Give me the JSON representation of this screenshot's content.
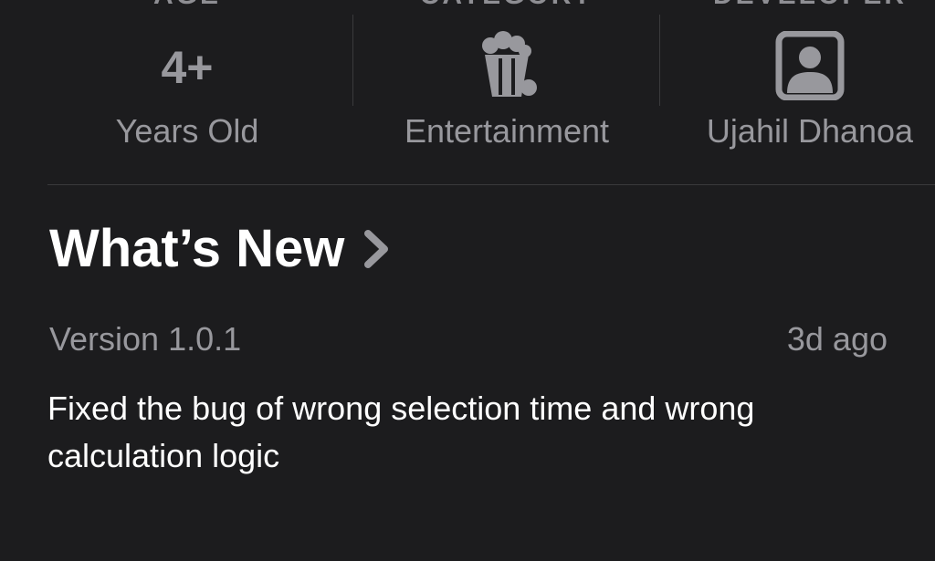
{
  "info": {
    "age": {
      "header": "AGE",
      "value": "4+",
      "label": "Years Old"
    },
    "category": {
      "header": "CATEGORY",
      "icon": "popcorn-icon",
      "label": "Entertainment"
    },
    "developer": {
      "header": "DEVELOPER",
      "icon": "person-square-icon",
      "label": "Ujahil Dhanoa"
    }
  },
  "whats_new": {
    "title": "What’s New",
    "chevron_icon": "chevron-right-icon",
    "version": "Version 1.0.1",
    "date": "3d ago",
    "notes": "Fixed the bug of wrong selection time and wrong calculation logic"
  },
  "colors": {
    "background": "#1c1c1e",
    "primary_text": "#ffffff",
    "secondary_text": "#98989d",
    "separator": "#3a3a3c"
  }
}
